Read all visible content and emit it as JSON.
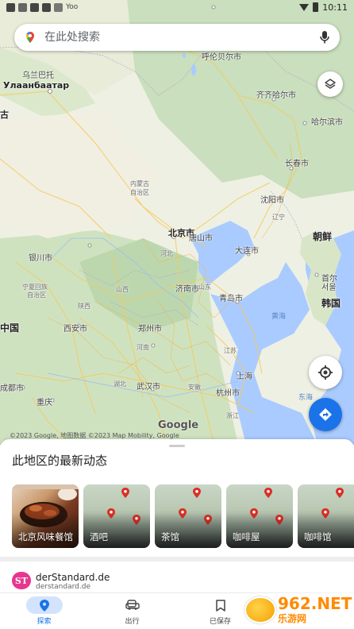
{
  "status_bar": {
    "time": "10:11",
    "carrier_text": "Yoo"
  },
  "search": {
    "placeholder": "在此处搜索",
    "mic_icon": "mic-icon",
    "logo_icon": "maps-pin-icon"
  },
  "map": {
    "labels": {
      "ulan_ude_region": "乌兰巴托",
      "ulaanbaatar": "Улаанбаатар",
      "hulunbuir": "呼伦贝尔市",
      "qiqihar": "齐齐哈尔市",
      "harbin": "哈尔滨市",
      "changchun": "长春市",
      "inner_mongolia_1": "内蒙古",
      "inner_mongolia_2": "自治区",
      "beijing": "北京市",
      "tangshan": "唐山市",
      "shenyang": "沈阳市",
      "liaoning": "辽宁",
      "north_korea": "朝鲜",
      "dalian": "大连市",
      "yinchuan": "银川市",
      "hebei": "河北",
      "jinan": "济南市",
      "seoul_1": "首尔",
      "seoul_2": "서울",
      "korea": "韩国",
      "ningxia_1": "宁夏回族",
      "ningxia_2": "自治区",
      "shanxi": "山西",
      "shandong": "山东",
      "qingdao": "青岛市",
      "yellow_sea": "黄海",
      "shaanxi": "陕西",
      "china": "中国",
      "xian": "西安市",
      "zhengzhou": "郑州市",
      "henan": "河南",
      "jiangsu": "江苏",
      "shanghai": "上海",
      "hubei": "湖北",
      "wuhan": "武汉市",
      "anhui": "安徽",
      "hangzhou": "杭州市",
      "east_china_sea": "东海",
      "chengdu": "成都市",
      "chongqing": "重庆",
      "zhejiang": "浙江",
      "gu": "古"
    },
    "google_logo": "Google",
    "copyright": "©2023 Google, 地图数据 ©2023 Map Mobility, Google"
  },
  "sheet": {
    "title": "此地区的最新动态",
    "cards": [
      {
        "label": "北京风味餐馆",
        "kind": "photo"
      },
      {
        "label": "酒吧",
        "kind": "map"
      },
      {
        "label": "茶馆",
        "kind": "map"
      },
      {
        "label": "咖啡屋",
        "kind": "map"
      },
      {
        "label": "咖啡馆",
        "kind": "map"
      }
    ],
    "news": {
      "logo_text": "ST",
      "title": "derStandard.de",
      "domain": "derstandard.de"
    }
  },
  "bottom_nav": {
    "items": [
      {
        "label": "探索",
        "icon": "location-pin-icon",
        "active": true
      },
      {
        "label": "出行",
        "icon": "car-icon",
        "active": false
      },
      {
        "label": "已保存",
        "icon": "bookmark-icon",
        "active": false
      }
    ]
  },
  "watermark": {
    "top": "962.NET",
    "bottom": "乐游网"
  },
  "colors": {
    "accent": "#1a73e8",
    "land": "#e6efd9",
    "water": "#aacbff"
  }
}
